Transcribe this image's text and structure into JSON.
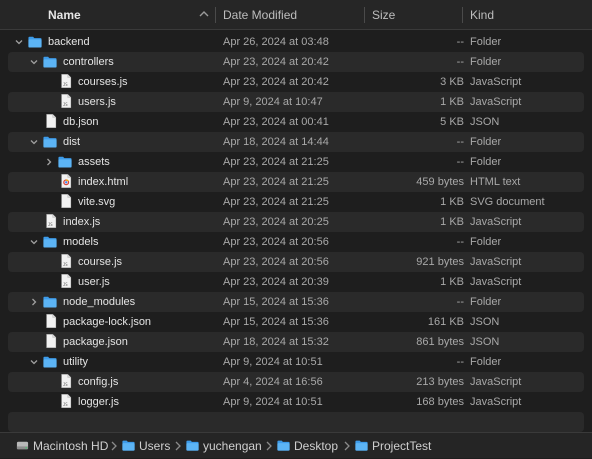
{
  "columns": {
    "name": "Name",
    "date_modified": "Date Modified",
    "size": "Size",
    "kind": "Kind"
  },
  "rows": [
    {
      "name": "backend",
      "date": "Apr 26, 2024 at 03:48",
      "size": "--",
      "kind": "Folder",
      "type": "folder",
      "depth": 0,
      "expanded": true
    },
    {
      "name": "controllers",
      "date": "Apr 23, 2024 at 20:42",
      "size": "--",
      "kind": "Folder",
      "type": "folder",
      "depth": 1,
      "expanded": true
    },
    {
      "name": "courses.js",
      "date": "Apr 23, 2024 at 20:42",
      "size": "3 KB",
      "kind": "JavaScript",
      "type": "js",
      "depth": 2
    },
    {
      "name": "users.js",
      "date": "Apr 9, 2024 at 10:47",
      "size": "1 KB",
      "kind": "JavaScript",
      "type": "js",
      "depth": 2
    },
    {
      "name": "db.json",
      "date": "Apr 23, 2024 at 00:41",
      "size": "5 KB",
      "kind": "JSON",
      "type": "doc",
      "depth": 1
    },
    {
      "name": "dist",
      "date": "Apr 18, 2024 at 14:44",
      "size": "--",
      "kind": "Folder",
      "type": "folder",
      "depth": 1,
      "expanded": true
    },
    {
      "name": "assets",
      "date": "Apr 23, 2024 at 21:25",
      "size": "--",
      "kind": "Folder",
      "type": "folder",
      "depth": 2,
      "expanded": false
    },
    {
      "name": "index.html",
      "date": "Apr 23, 2024 at 21:25",
      "size": "459 bytes",
      "kind": "HTML text",
      "type": "html",
      "depth": 2
    },
    {
      "name": "vite.svg",
      "date": "Apr 23, 2024 at 21:25",
      "size": "1 KB",
      "kind": "SVG document",
      "type": "doc",
      "depth": 2
    },
    {
      "name": "index.js",
      "date": "Apr 23, 2024 at 20:25",
      "size": "1 KB",
      "kind": "JavaScript",
      "type": "js",
      "depth": 1
    },
    {
      "name": "models",
      "date": "Apr 23, 2024 at 20:56",
      "size": "--",
      "kind": "Folder",
      "type": "folder",
      "depth": 1,
      "expanded": true
    },
    {
      "name": "course.js",
      "date": "Apr 23, 2024 at 20:56",
      "size": "921 bytes",
      "kind": "JavaScript",
      "type": "js",
      "depth": 2
    },
    {
      "name": "user.js",
      "date": "Apr 23, 2024 at 20:39",
      "size": "1 KB",
      "kind": "JavaScript",
      "type": "js",
      "depth": 2
    },
    {
      "name": "node_modules",
      "date": "Apr 15, 2024 at 15:36",
      "size": "--",
      "kind": "Folder",
      "type": "folder",
      "depth": 1,
      "expanded": false
    },
    {
      "name": "package-lock.json",
      "date": "Apr 15, 2024 at 15:36",
      "size": "161 KB",
      "kind": "JSON",
      "type": "doc",
      "depth": 1
    },
    {
      "name": "package.json",
      "date": "Apr 18, 2024 at 15:32",
      "size": "861 bytes",
      "kind": "JSON",
      "type": "doc",
      "depth": 1
    },
    {
      "name": "utility",
      "date": "Apr 9, 2024 at 10:51",
      "size": "--",
      "kind": "Folder",
      "type": "folder",
      "depth": 1,
      "expanded": true
    },
    {
      "name": "config.js",
      "date": "Apr 4, 2024 at 16:56",
      "size": "213 bytes",
      "kind": "JavaScript",
      "type": "js",
      "depth": 2
    },
    {
      "name": "logger.js",
      "date": "Apr 9, 2024 at 10:51",
      "size": "168 bytes",
      "kind": "JavaScript",
      "type": "js",
      "depth": 2
    }
  ],
  "path": [
    {
      "label": "Macintosh HD",
      "icon": "hard-drive-icon"
    },
    {
      "label": "Users",
      "icon": "folder-icon"
    },
    {
      "label": "yuchengan",
      "icon": "folder-icon"
    },
    {
      "label": "Desktop",
      "icon": "folder-icon"
    },
    {
      "label": "ProjectTest",
      "icon": "folder-icon"
    }
  ],
  "colors": {
    "folder": "#3d9be9",
    "background": "#1e1e1e",
    "row_alt": "#2a2a2a"
  }
}
